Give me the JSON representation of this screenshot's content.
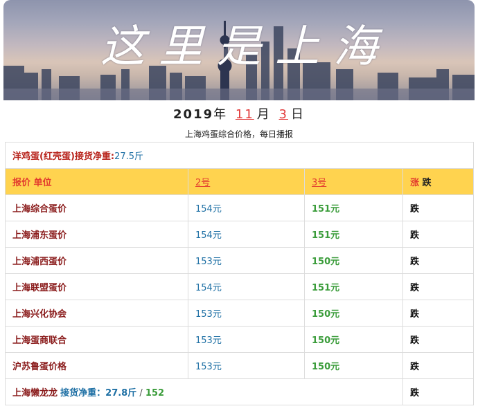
{
  "banner": {
    "title": "这里是上海"
  },
  "date": {
    "year": "2019",
    "year_unit": "年",
    "month": "11",
    "month_unit": "月",
    "day": "3",
    "day_unit": "日"
  },
  "subtitle": "上海鸡蛋综合价格，每日播报",
  "table": {
    "title": "洋鸡蛋(红壳蛋)接货净重:",
    "title_weight": "27.5斤",
    "headers": {
      "name": "报价 单位",
      "day2": "2号",
      "day3": "3号",
      "change_a": "涨",
      "change_b": "跌"
    },
    "rows": [
      {
        "name": "上海综合蛋价",
        "day2": "154元",
        "day3": "151元",
        "change": "跌"
      },
      {
        "name": "上海浦东蛋价",
        "day2": "154元",
        "day3": "151元",
        "change": "跌"
      },
      {
        "name": "上海浦西蛋价",
        "day2": "153元",
        "day3": "150元",
        "change": "跌"
      },
      {
        "name": "上海联盟蛋价",
        "day2": "154元",
        "day3": "151元",
        "change": "跌"
      },
      {
        "name": "上海兴化协会",
        "day2": "153元",
        "day3": "150元",
        "change": "跌"
      },
      {
        "name": "上海蛋商联合",
        "day2": "153元",
        "day3": "150元",
        "change": "跌"
      },
      {
        "name": "沪苏鲁蛋价格",
        "day2": "153元",
        "day3": "150元",
        "change": "跌"
      }
    ],
    "footer": {
      "name": "上海懒龙龙",
      "label": "接货净重：27.8斤",
      "slash": "/",
      "value": "152",
      "change": "跌"
    }
  }
}
